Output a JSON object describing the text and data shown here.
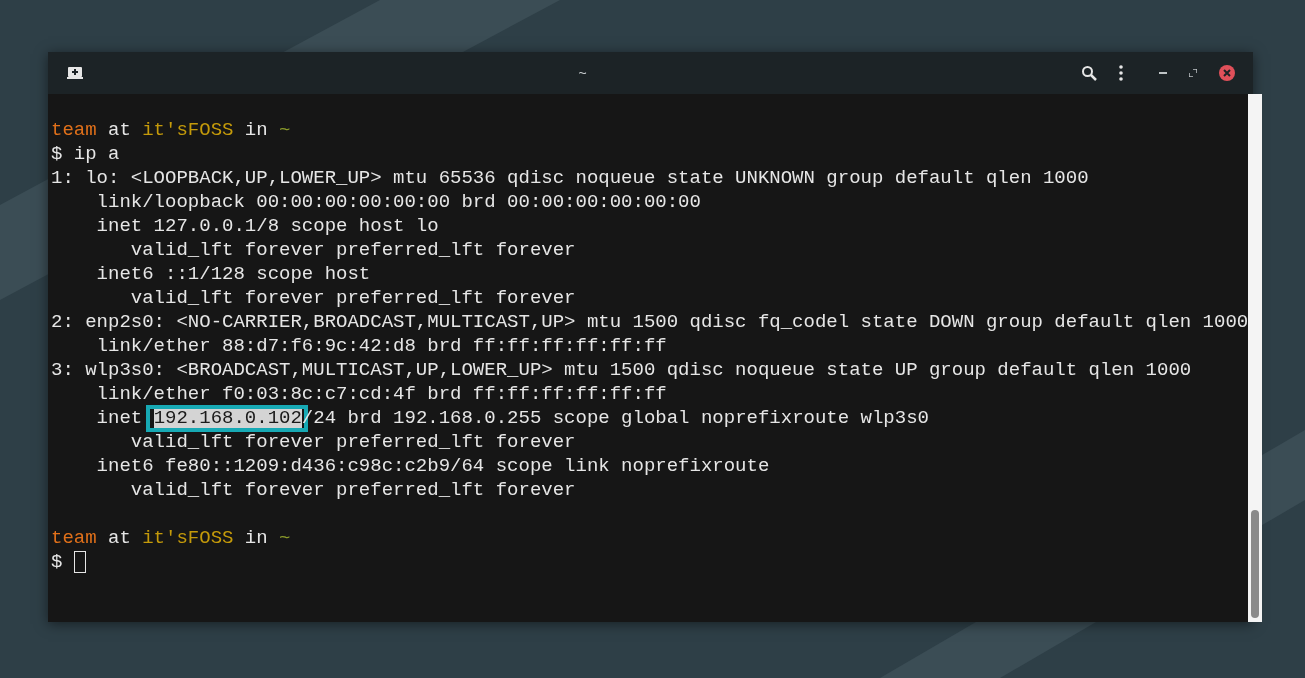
{
  "window": {
    "title": "~"
  },
  "terminal": {
    "lines": [
      {
        "kind": "text",
        "segments": [
          {
            "text": "team",
            "kind": "user"
          },
          {
            "text": " at ",
            "kind": "plain"
          },
          {
            "text": "it'sFOSS",
            "kind": "host"
          },
          {
            "text": " in ",
            "kind": "plain"
          },
          {
            "text": "~",
            "kind": "path"
          }
        ]
      },
      {
        "kind": "text",
        "segments": [
          {
            "text": "$ ip a",
            "kind": "plain"
          }
        ]
      },
      {
        "kind": "text",
        "segments": [
          {
            "text": "1: lo: <LOOPBACK,UP,LOWER_UP> mtu 65536 qdisc noqueue state UNKNOWN group default qlen 1000",
            "kind": "plain"
          }
        ]
      },
      {
        "kind": "text",
        "segments": [
          {
            "text": "    link/loopback 00:00:00:00:00:00 brd 00:00:00:00:00:00",
            "kind": "plain"
          }
        ]
      },
      {
        "kind": "text",
        "segments": [
          {
            "text": "    inet 127.0.0.1/8 scope host lo",
            "kind": "plain"
          }
        ]
      },
      {
        "kind": "text",
        "segments": [
          {
            "text": "       valid_lft forever preferred_lft forever",
            "kind": "plain"
          }
        ]
      },
      {
        "kind": "text",
        "segments": [
          {
            "text": "    inet6 ::1/128 scope host",
            "kind": "plain"
          }
        ]
      },
      {
        "kind": "text",
        "segments": [
          {
            "text": "       valid_lft forever preferred_lft forever",
            "kind": "plain"
          }
        ]
      },
      {
        "kind": "text",
        "segments": [
          {
            "text": "2: enp2s0: <NO-CARRIER,BROADCAST,MULTICAST,UP> mtu 1500 qdisc fq_codel state DOWN group default qlen 1000",
            "kind": "plain"
          }
        ]
      },
      {
        "kind": "text",
        "segments": [
          {
            "text": "    link/ether 88:d7:f6:9c:42:d8 brd ff:ff:ff:ff:ff:ff",
            "kind": "plain"
          }
        ]
      },
      {
        "kind": "text",
        "segments": [
          {
            "text": "3: wlp3s0: <BROADCAST,MULTICAST,UP,LOWER_UP> mtu 1500 qdisc noqueue state UP group default qlen 1000",
            "kind": "plain"
          }
        ]
      },
      {
        "kind": "text",
        "segments": [
          {
            "text": "    link/ether f0:03:8c:c7:cd:4f brd ff:ff:ff:ff:ff:ff",
            "kind": "plain"
          }
        ]
      },
      {
        "kind": "text",
        "segments": [
          {
            "text": "    inet ",
            "kind": "plain"
          },
          {
            "text": "192.168.0.102",
            "kind": "selection",
            "boxed": true
          },
          {
            "text": "/24 brd 192.168.0.255 scope global noprefixroute wlp3s0",
            "kind": "plain"
          }
        ]
      },
      {
        "kind": "text",
        "segments": [
          {
            "text": "       valid_lft forever preferred_lft forever",
            "kind": "plain"
          }
        ]
      },
      {
        "kind": "text",
        "segments": [
          {
            "text": "    inet6 fe80::1209:d436:c98c:c2b9/64 scope link noprefixroute",
            "kind": "plain"
          }
        ]
      },
      {
        "kind": "text",
        "segments": [
          {
            "text": "       valid_lft forever preferred_lft forever",
            "kind": "plain"
          }
        ]
      },
      {
        "kind": "blank"
      },
      {
        "kind": "text",
        "segments": [
          {
            "text": "team",
            "kind": "user"
          },
          {
            "text": " at ",
            "kind": "plain"
          },
          {
            "text": "it'sFOSS",
            "kind": "host"
          },
          {
            "text": " in ",
            "kind": "plain"
          },
          {
            "text": "~",
            "kind": "path"
          }
        ]
      },
      {
        "kind": "text",
        "segments": [
          {
            "text": "$ ",
            "kind": "plain"
          },
          {
            "kind": "cursor"
          }
        ]
      }
    ]
  }
}
